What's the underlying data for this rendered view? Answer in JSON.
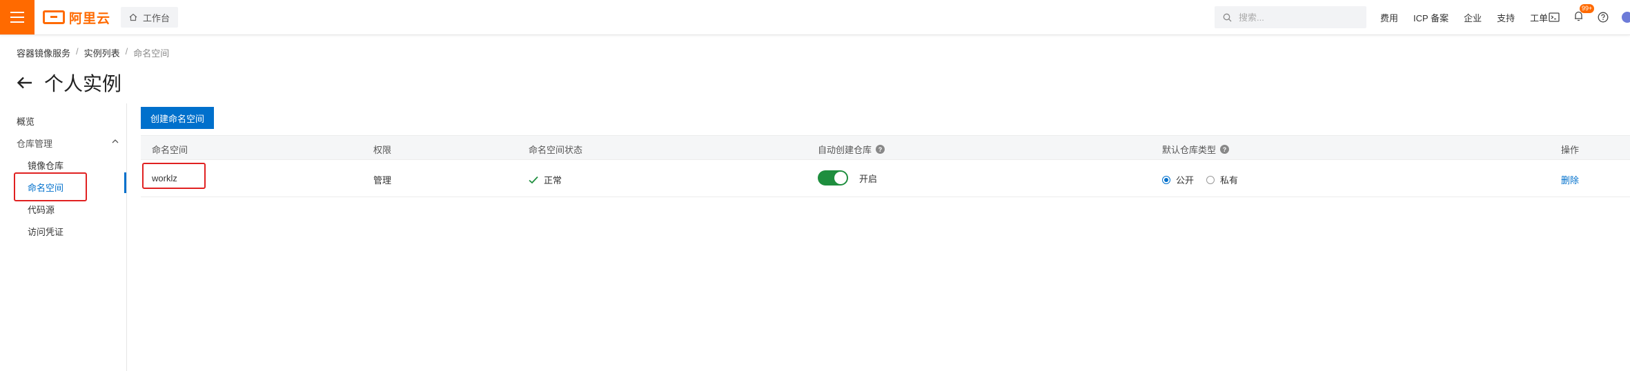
{
  "topbar": {
    "logo_text": "阿里云",
    "workbench_label": "工作台",
    "search_placeholder": "搜索...",
    "nav_links": [
      "费用",
      "ICP 备案",
      "企业",
      "支持",
      "工单"
    ],
    "notification_badge": "99+",
    "brand_color": "#ff6a00"
  },
  "breadcrumb": {
    "items": [
      "容器镜像服务",
      "实例列表",
      "命名空间"
    ]
  },
  "page": {
    "back_icon": "arrow-left-icon",
    "title": "个人实例"
  },
  "sidenav": {
    "overview": "概览",
    "repo_group": "仓库管理",
    "items": [
      "镜像仓库",
      "命名空间",
      "代码源",
      "访问凭证"
    ],
    "active_item": "命名空间",
    "accent_color": "#0070cc"
  },
  "main": {
    "create_button": "创建命名空间",
    "columns": {
      "namespace": "命名空间",
      "permission": "权限",
      "status": "命名空间状态",
      "auto_create": "自动创建仓库",
      "default_type": "默认仓库类型",
      "actions": "操作"
    },
    "rows": [
      {
        "namespace": "worklz",
        "permission": "管理",
        "status": "正常",
        "auto_create_label": "开启",
        "auto_create_on": true,
        "type_public": "公开",
        "type_private": "私有",
        "selected_type": "公开",
        "action_delete": "删除"
      }
    ]
  }
}
